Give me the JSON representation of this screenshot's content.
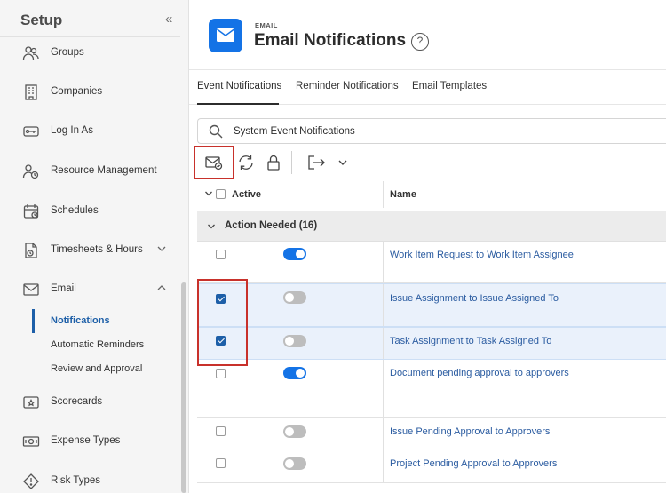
{
  "sidebar": {
    "title": "Setup",
    "collapse_glyph": "«",
    "items": [
      {
        "label": "Groups",
        "icon": "groups-icon"
      },
      {
        "label": "Companies",
        "icon": "building-icon"
      },
      {
        "label": "Log In As",
        "icon": "key-icon"
      },
      {
        "label": "Resource Management",
        "icon": "resource-management-icon"
      },
      {
        "label": "Schedules",
        "icon": "calendar-icon"
      },
      {
        "label": "Timesheets & Hours",
        "icon": "timesheet-icon",
        "expandable": true
      },
      {
        "label": "Email",
        "icon": "envelope-icon",
        "expanded": true
      },
      {
        "label": "Scorecards",
        "icon": "scorecard-icon"
      },
      {
        "label": "Expense Types",
        "icon": "money-icon"
      },
      {
        "label": "Risk Types",
        "icon": "risk-icon"
      }
    ],
    "email_subitems": [
      {
        "label": "Notifications",
        "active": true
      },
      {
        "label": "Automatic Reminders"
      },
      {
        "label": "Review and Approval"
      }
    ]
  },
  "header": {
    "kicker": "EMAIL",
    "title": "Email Notifications",
    "help_glyph": "?"
  },
  "tabs": [
    {
      "label": "Event Notifications",
      "active": true
    },
    {
      "label": "Reminder Notifications"
    },
    {
      "label": "Email Templates"
    }
  ],
  "search": {
    "value": "System Event Notifications"
  },
  "toolbar": {
    "icons": [
      "mark-email-icon",
      "refresh-icon",
      "lock-icon",
      "export-icon",
      "chevron-down-icon"
    ]
  },
  "table": {
    "headers": {
      "active": "Active",
      "name": "Name"
    },
    "group": {
      "label": "Action Needed (16)"
    },
    "rows": [
      {
        "name": "Work Item Request to Work Item Assignee",
        "checked": false,
        "active": true
      },
      {
        "name": "Issue Assignment to Issue Assigned To",
        "checked": true,
        "active": false
      },
      {
        "name": "Task Assignment to Task Assigned To",
        "checked": true,
        "active": false
      },
      {
        "name": "Document pending approval to approvers",
        "checked": false,
        "active": true
      },
      {
        "name": "Issue Pending Approval to Approvers",
        "checked": false,
        "active": false
      },
      {
        "name": "Project Pending Approval to Approvers",
        "checked": false,
        "active": false
      }
    ]
  },
  "colors": {
    "accent": "#1473e6",
    "highlight": "#c8312b",
    "link": "#2a5ba0"
  }
}
